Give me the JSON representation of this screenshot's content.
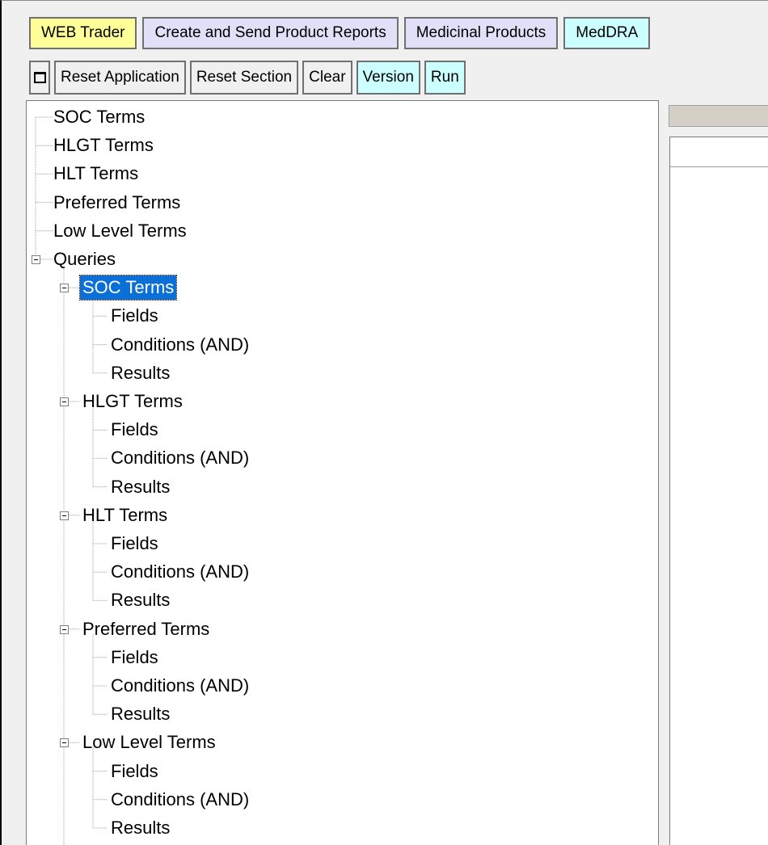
{
  "tabs": [
    {
      "label": "WEB Trader",
      "color": "#ffff99"
    },
    {
      "label": "Create and Send Product Reports",
      "color": "#e0e0f8"
    },
    {
      "label": "Medicinal Products",
      "color": "#e0e0f8"
    },
    {
      "label": "MedDRA",
      "color": "#ccffff"
    }
  ],
  "toolbar": {
    "window_icon": "window-square-icon",
    "reset_application": "Reset Application",
    "reset_section": "Reset Section",
    "clear": "Clear",
    "version": "Version",
    "run": "Run"
  },
  "tree": {
    "top_items": [
      "SOC Terms",
      "HLGT Terms",
      "HLT Terms",
      "Preferred Terms",
      "Low Level Terms"
    ],
    "queries_label": "Queries",
    "query_groups": [
      {
        "label": "SOC Terms",
        "selected": true,
        "children": [
          "Fields",
          "Conditions (AND)",
          "Results"
        ]
      },
      {
        "label": "HLGT Terms",
        "selected": false,
        "children": [
          "Fields",
          "Conditions (AND)",
          "Results"
        ]
      },
      {
        "label": "HLT Terms",
        "selected": false,
        "children": [
          "Fields",
          "Conditions (AND)",
          "Results"
        ]
      },
      {
        "label": "Preferred Terms",
        "selected": false,
        "children": [
          "Fields",
          "Conditions (AND)",
          "Results"
        ]
      },
      {
        "label": "Low Level Terms",
        "selected": false,
        "children": [
          "Fields",
          "Conditions (AND)",
          "Results"
        ]
      }
    ]
  },
  "colors": {
    "selection": "#0a6fd6",
    "tab_yellow": "#ffff99",
    "tab_purple": "#e0e0f8",
    "accent_cyan": "#ccffff"
  }
}
